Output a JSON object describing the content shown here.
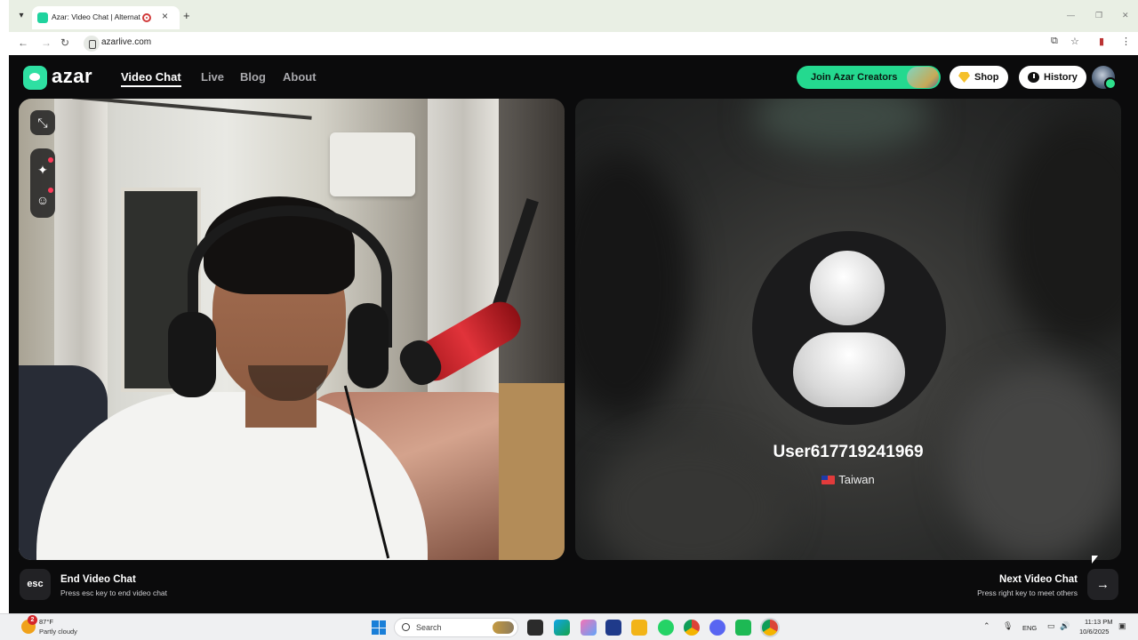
{
  "browser": {
    "tab_title": "Azar: Video Chat | Alternati",
    "url": "azarlive.com"
  },
  "header": {
    "logo_text": "azar",
    "nav": [
      "Video Chat",
      "Live",
      "Blog",
      "About"
    ],
    "creators_label": "Join Azar Creators",
    "shop_label": "Shop",
    "history_label": "History"
  },
  "remote": {
    "username": "User617719241969",
    "country": "Taiwan"
  },
  "controls": {
    "esc_label": "esc",
    "end_title": "End Video Chat",
    "end_hint": "Press esc key to end video chat",
    "next_title": "Next Video Chat",
    "next_hint": "Press right key to meet others",
    "next_icon": "arrow-right-icon"
  },
  "taskbar": {
    "weather_badge": "2",
    "weather_temp": "87°F",
    "weather_desc": "Partly cloudy",
    "search_placeholder": "Search",
    "lang": "ENG",
    "time": "11:13 PM",
    "date": "10/6/2025"
  },
  "colors": {
    "accent": "#24d98f",
    "background": "#0b0b0c",
    "notification": "#ff3b5a"
  }
}
